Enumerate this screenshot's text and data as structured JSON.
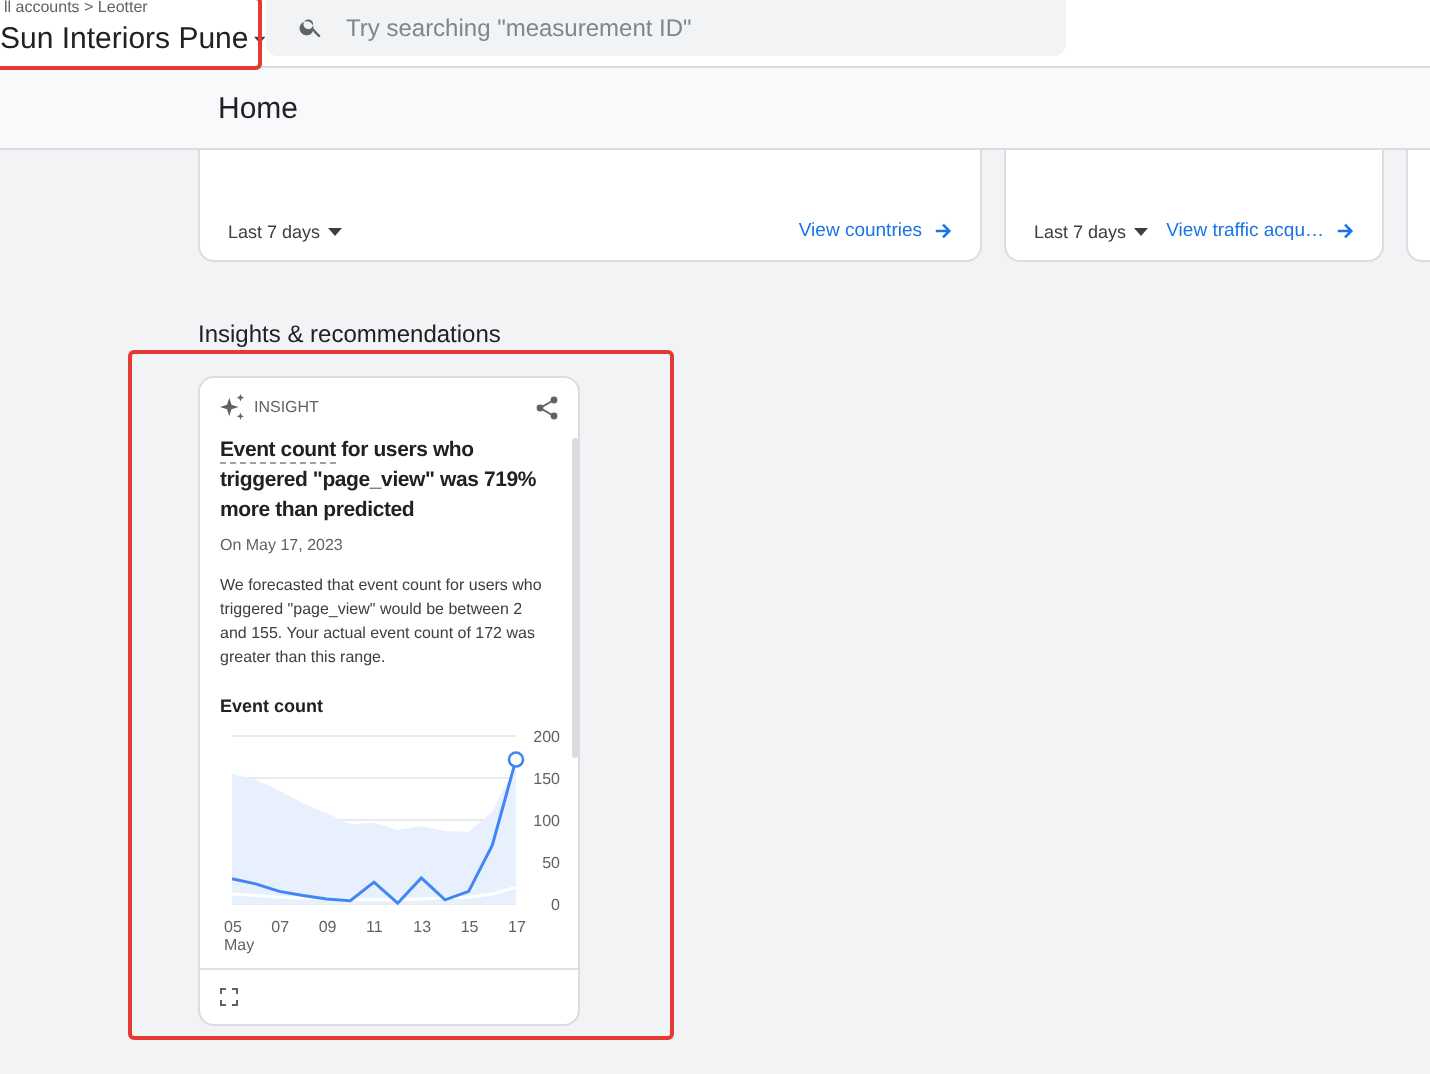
{
  "header": {
    "breadcrumb": "ll accounts > Leotter",
    "property": "Sun Interiors Pune",
    "search": {
      "placeholder": "Try searching \"measurement ID\""
    }
  },
  "page_title": "Home",
  "top_cards": [
    {
      "period": "Last 7 days",
      "link": "View countries"
    },
    {
      "period": "Last 7 days",
      "link": "View traffic acqu…"
    }
  ],
  "section_title": "Insights & recommendations",
  "insight": {
    "tag": "INSIGHT",
    "title_term": "Event count",
    "title_rest": " for users who triggered \"page_view\" was 719% more than predicted",
    "date": "On May 17, 2023",
    "body": "We forecasted that event count for users who triggered \"page_view\" would be between 2 and 155. Your actual event count of 172 was greater than this range.",
    "chart_title": "Event count",
    "chart_data": {
      "type": "line",
      "x": [
        5,
        6,
        7,
        8,
        9,
        10,
        11,
        12,
        13,
        14,
        15,
        16,
        17
      ],
      "xlim": [
        5,
        17
      ],
      "xticks": [
        {
          "value": 5,
          "label": "05"
        },
        {
          "value": 7,
          "label": "07"
        },
        {
          "value": 9,
          "label": "09"
        },
        {
          "value": 11,
          "label": "11"
        },
        {
          "value": 13,
          "label": "13"
        },
        {
          "value": 15,
          "label": "15"
        },
        {
          "value": 17,
          "label": "17"
        }
      ],
      "xlabel": "May",
      "ylim": [
        0,
        200
      ],
      "grid": true,
      "yticks": [
        0,
        50,
        100,
        150,
        200
      ],
      "series": [
        {
          "type": "area",
          "color": "#e8f0fe",
          "values": [
            155,
            148,
            135,
            120,
            108,
            95,
            97,
            88,
            93,
            87,
            86,
            110,
            165
          ]
        },
        {
          "type": "line",
          "color": "#ffffff",
          "values": [
            12,
            10,
            8,
            7,
            6,
            5,
            5,
            5,
            6,
            7,
            8,
            12,
            20
          ]
        },
        {
          "type": "line",
          "color": "#4285f4",
          "values": [
            30,
            24,
            15,
            10,
            6,
            4,
            26,
            1,
            31,
            5,
            15,
            70,
            172
          ]
        }
      ]
    }
  }
}
